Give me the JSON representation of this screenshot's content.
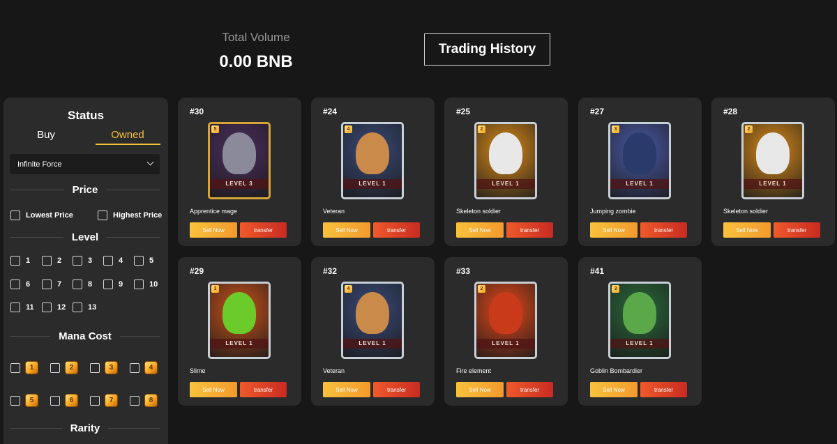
{
  "header": {
    "volume_label": "Total Volume",
    "volume_value": "0.00 BNB",
    "trading_history_label": "Trading History"
  },
  "sidebar": {
    "status_title": "Status",
    "tab_buy": "Buy",
    "tab_owned": "Owned",
    "active_tab": "Owned",
    "game_select": "Infinite Force",
    "price_title": "Price",
    "price_options": [
      "Lowest Price",
      "Highest Price"
    ],
    "level_title": "Level",
    "levels": [
      "1",
      "2",
      "3",
      "4",
      "5",
      "6",
      "7",
      "8",
      "9",
      "10",
      "11",
      "12",
      "13"
    ],
    "mana_title": "Mana Cost",
    "mana": [
      "1",
      "2",
      "3",
      "4",
      "5",
      "6",
      "7",
      "8"
    ],
    "rarity_title": "Rarity"
  },
  "colors": {
    "accent": "#f6c03a",
    "sell_button": "#f39a2d",
    "transfer_button": "#d9352a",
    "card_bg": "#2b2b2b",
    "page_bg": "#171717"
  },
  "cards": [
    {
      "id": "#30",
      "name": "Apprentice mage",
      "level": "LEVEL 3",
      "cost": "5",
      "frame": "gold",
      "art": "mage-art",
      "bg": "#4b2e5e",
      "fig": "#8a8a9a"
    },
    {
      "id": "#24",
      "name": "Veteran",
      "level": "LEVEL 1",
      "cost": "4",
      "frame": "silver",
      "art": "veteran-art",
      "bg": "#3a4a7a",
      "fig": "#c98a4a"
    },
    {
      "id": "#25",
      "name": "Skeleton soldier",
      "level": "LEVEL 1",
      "cost": "2",
      "frame": "silver",
      "art": "skeleton-art",
      "bg": "#d98a1a",
      "fig": "#e8e8e8"
    },
    {
      "id": "#27",
      "name": "Jumping zombie",
      "level": "LEVEL 1",
      "cost": "3",
      "frame": "silver",
      "art": "zombie-art",
      "bg": "#4a5aa8",
      "fig": "#2a3a6a"
    },
    {
      "id": "#28",
      "name": "Skeleton soldier",
      "level": "LEVEL 1",
      "cost": "2",
      "frame": "silver",
      "art": "skeleton-art",
      "bg": "#d98a1a",
      "fig": "#e8e8e8"
    },
    {
      "id": "#29",
      "name": "Slime",
      "level": "LEVEL 1",
      "cost": "3",
      "frame": "silver",
      "art": "slime-art",
      "bg": "#c9521a",
      "fig": "#6acb2a"
    },
    {
      "id": "#32",
      "name": "Veteran",
      "level": "LEVEL 1",
      "cost": "4",
      "frame": "silver",
      "art": "veteran-art",
      "bg": "#3a4a7a",
      "fig": "#c98a4a"
    },
    {
      "id": "#33",
      "name": "Fire element",
      "level": "LEVEL 1",
      "cost": "2",
      "frame": "silver",
      "art": "fire-art",
      "bg": "#e0481a",
      "fig": "#c93a1a"
    },
    {
      "id": "#41",
      "name": "Goblin Bombardier",
      "level": "LEVEL 1",
      "cost": "3",
      "frame": "silver",
      "art": "goblin-art",
      "bg": "#2a6a3a",
      "fig": "#5aa84a"
    }
  ],
  "card_actions": {
    "sell": "Sell Now",
    "transfer": "transfer"
  }
}
